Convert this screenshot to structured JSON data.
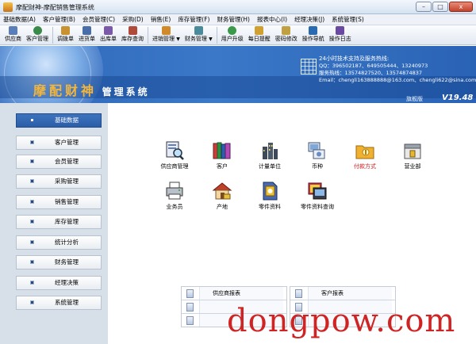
{
  "window": {
    "title": "摩配财神-摩配销售管理系统",
    "minimize": "–",
    "maximize": "□",
    "close": "x"
  },
  "menu": [
    "基础数据(A)",
    "客户管理(B)",
    "会员管理(C)",
    "采购(D)",
    "销售(E)",
    "库存管理(F)",
    "财务管理(H)",
    "报表中心(I)",
    "经理决策(J)",
    "系统管理(S)"
  ],
  "toolbar": {
    "items": [
      {
        "label": "供应商",
        "icon": "supplier-icon",
        "color": "#5a7fb8"
      },
      {
        "label": "客户管理",
        "icon": "customer-icon",
        "color": "#3b8a4a"
      },
      {
        "label": "调拨单",
        "icon": "transfer-icon",
        "color": "#c9912f"
      },
      {
        "label": "进货单",
        "icon": "purchase-icon",
        "color": "#4a6fa8"
      },
      {
        "label": "出库单",
        "icon": "outbound-icon",
        "color": "#7a5aa8"
      },
      {
        "label": "库存查询",
        "icon": "stock-query-icon",
        "color": "#b04a3a"
      },
      {
        "label": "进销管理",
        "icon": "sales-mgmt-icon",
        "color": "#d08a2a"
      },
      {
        "label": "财务管理",
        "icon": "finance-icon",
        "color": "#4a8a9a"
      },
      {
        "label": "用户升级",
        "icon": "upgrade-icon",
        "color": "#3a9a4a"
      },
      {
        "label": "每日提醒",
        "icon": "reminder-icon",
        "color": "#d0a030"
      },
      {
        "label": "密码修改",
        "icon": "password-icon",
        "color": "#c0a040"
      },
      {
        "label": "操作导航",
        "icon": "navigation-icon",
        "color": "#2a6ab0"
      },
      {
        "label": "操作日志",
        "icon": "log-icon",
        "color": "#6a4aa0"
      }
    ]
  },
  "banner": {
    "brand_main": "摩配财神",
    "brand_sub": "管理系统",
    "support_heading": "24小时技术支持及服务热线:",
    "qq": "QQ：396502187、649505444、13240973",
    "hotline": "服务热线：13574827520、13574874837",
    "email": "Email：chengli163888888@163.com、chengli622@sina.com",
    "edition": "旗舰版",
    "version": "V19.48"
  },
  "sidebar": {
    "items": [
      {
        "label": "基础数据",
        "active": true
      },
      {
        "label": "客户管理",
        "active": false
      },
      {
        "label": "会员管理",
        "active": false
      },
      {
        "label": "采购管理",
        "active": false
      },
      {
        "label": "销售管理",
        "active": false
      },
      {
        "label": "库存管理",
        "active": false
      },
      {
        "label": "统计分析",
        "active": false
      },
      {
        "label": "财务管理",
        "active": false
      },
      {
        "label": "经理决策",
        "active": false
      },
      {
        "label": "系统管理",
        "active": false
      }
    ]
  },
  "modules": [
    {
      "label": "供应商管理",
      "icon": "supplier-search-icon"
    },
    {
      "label": "客户",
      "icon": "customer-books-icon"
    },
    {
      "label": "计量单位",
      "icon": "unit-building-icon"
    },
    {
      "label": "币种",
      "icon": "currency-icon"
    },
    {
      "label": "付款方式",
      "icon": "payment-folder-icon",
      "highlight": "#d02020"
    },
    {
      "label": "营业部",
      "icon": "branch-icon"
    },
    {
      "label": "业务员",
      "icon": "salesman-printer-icon"
    },
    {
      "label": "产地",
      "icon": "origin-house-icon"
    },
    {
      "label": "零件资料",
      "icon": "parts-doc-icon"
    },
    {
      "label": "零件资料查询",
      "icon": "parts-query-icon"
    }
  ],
  "reports": {
    "left": [
      "供应商报表",
      "",
      ""
    ],
    "right": [
      "客户报表",
      "",
      ""
    ]
  },
  "watermark": "dongpow.com"
}
